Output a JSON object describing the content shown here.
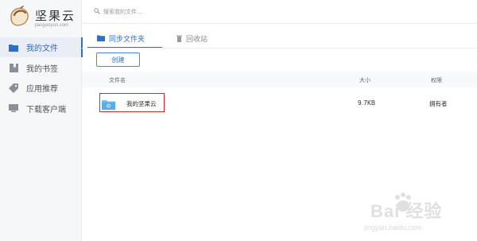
{
  "app": {
    "logo_text": "坚果云",
    "logo_sub": "jianguoyun.com"
  },
  "sidebar": {
    "items": [
      {
        "label": "我的文件",
        "icon": "folder-icon",
        "active": true
      },
      {
        "label": "我的书签",
        "icon": "bookmark-icon",
        "active": false
      },
      {
        "label": "应用推荐",
        "icon": "tag-icon",
        "active": false
      },
      {
        "label": "下载客户端",
        "icon": "monitor-icon",
        "active": false
      }
    ]
  },
  "search": {
    "placeholder": "搜索我的文件..."
  },
  "tabs": [
    {
      "label": "同步文件夹",
      "icon": "folder-icon",
      "active": true
    },
    {
      "label": "回收站",
      "icon": "trash-icon",
      "active": false
    }
  ],
  "toolbar": {
    "create_label": "创建"
  },
  "table": {
    "headers": {
      "name": "文件名",
      "size": "大小",
      "permission": "权限"
    },
    "rows": [
      {
        "name": "我的坚果云",
        "size": "9.7KB",
        "permission": "拥有者",
        "icon": "shared-folder-icon"
      }
    ]
  },
  "watermark": {
    "brand": "Bai  经验",
    "url": "jingyan.baidu.com"
  },
  "colors": {
    "accent": "#2f6fc4",
    "highlight": "#d8242b",
    "sidebar_bg": "#f6f7f9"
  }
}
